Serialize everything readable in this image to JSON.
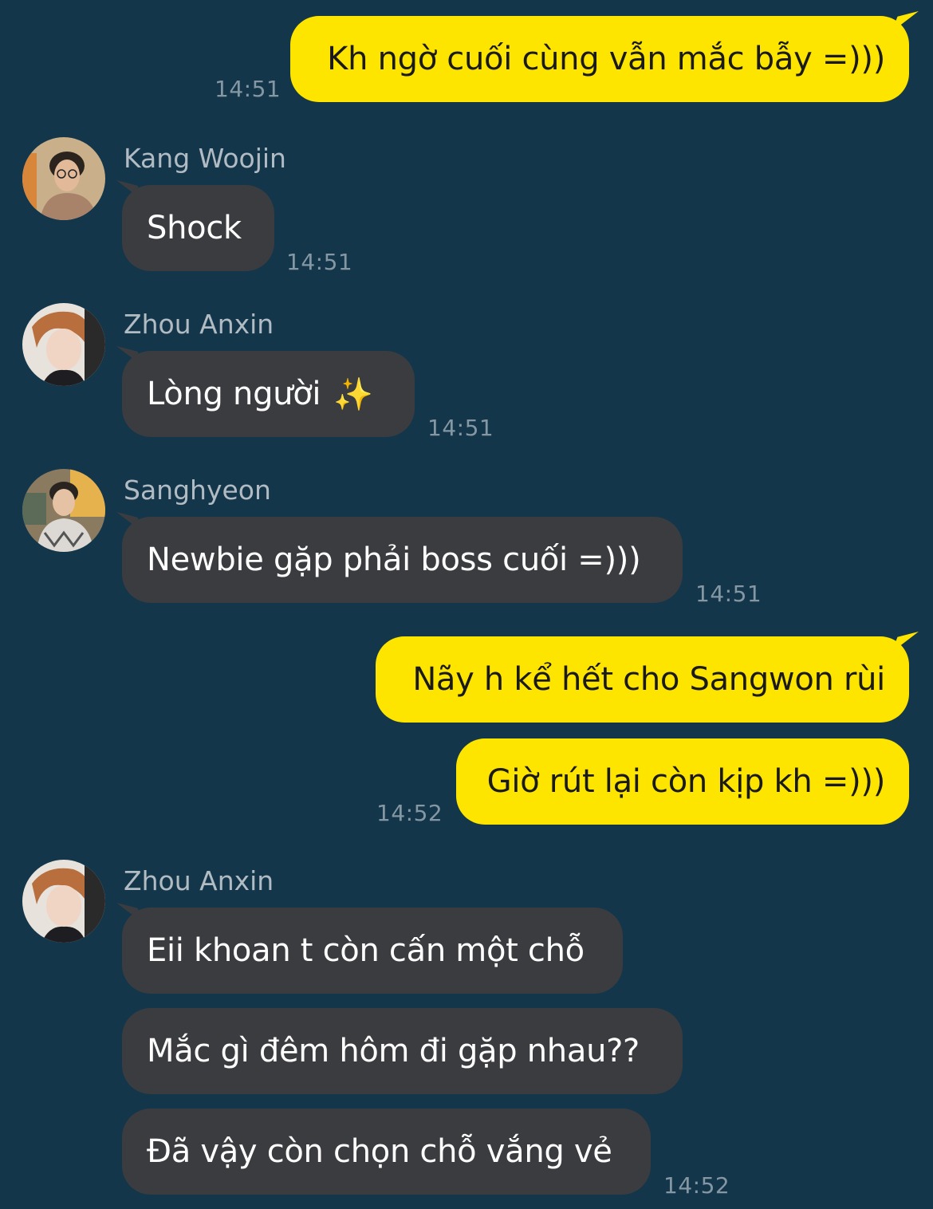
{
  "messages": [
    {
      "text": "Kh ngờ cuối cùng vẫn mắc bẫy =)))",
      "time": "14:51"
    },
    {
      "sender": "Kang Woojin",
      "text": "Shock",
      "time": "14:51"
    },
    {
      "sender": "Zhou Anxin",
      "text": "Lòng người",
      "emoji": "✨",
      "time": "14:51"
    },
    {
      "sender": "Sanghyeon",
      "text": "Newbie gặp phải boss cuối =)))",
      "time": "14:51"
    },
    {
      "text": "Nãy h kể hết cho Sangwon rùi"
    },
    {
      "text": "Giờ rút lại còn kịp kh =)))",
      "time": "14:52"
    },
    {
      "sender": "Zhou Anxin",
      "text": "Eii khoan t còn cấn một chỗ"
    },
    {
      "text": "Mắc gì đêm hôm đi gặp nhau??"
    },
    {
      "text": "Đã vậy còn chọn chỗ vắng vẻ",
      "time": "14:52"
    }
  ],
  "colors": {
    "background": "#14364a",
    "outgoing_bubble": "#fee500",
    "incoming_bubble": "#3b3c40"
  }
}
